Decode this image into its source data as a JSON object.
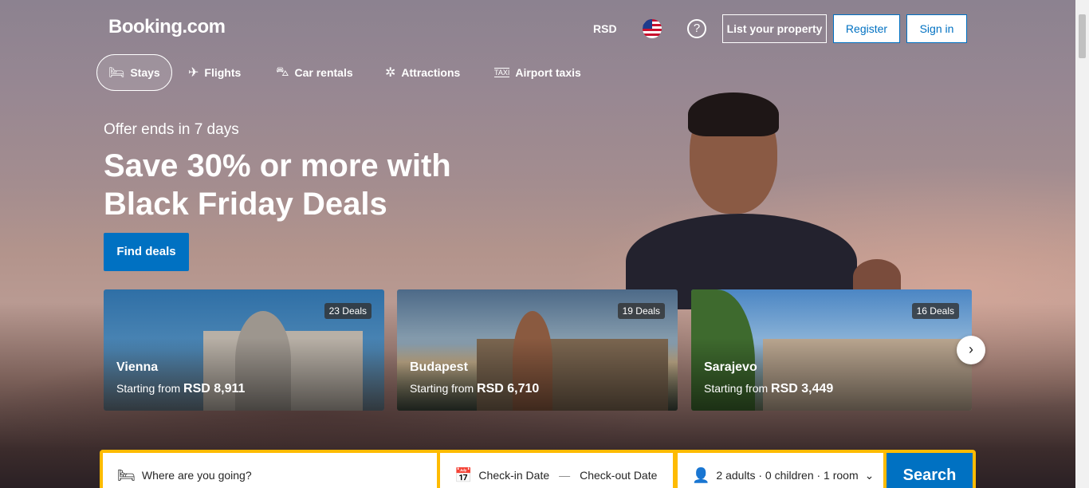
{
  "header": {
    "logo": "Booking.com",
    "currency": "RSD",
    "language_flag": "us-flag-icon",
    "help": "?",
    "list_property": "List your property",
    "register": "Register",
    "sign_in": "Sign in"
  },
  "nav": [
    {
      "label": "Stays",
      "icon": "bed-icon"
    },
    {
      "label": "Flights",
      "icon": "plane-icon"
    },
    {
      "label": "Car rentals",
      "icon": "car-icon"
    },
    {
      "label": "Attractions",
      "icon": "ferris-wheel-icon"
    },
    {
      "label": "Airport taxis",
      "icon": "taxi-icon"
    }
  ],
  "hero": {
    "offer": "Offer ends in 7 days",
    "title": "Save 30% or more with Black Friday Deals",
    "cta": "Find deals"
  },
  "deals": [
    {
      "city": "Vienna",
      "deals": "23 Deals",
      "starting": "Starting from",
      "price": "RSD 8,911"
    },
    {
      "city": "Budapest",
      "deals": "19 Deals",
      "starting": "Starting from",
      "price": "RSD 6,710"
    },
    {
      "city": "Sarajevo",
      "deals": "16 Deals",
      "starting": "Starting from",
      "price": "RSD 3,449"
    }
  ],
  "search": {
    "destination_placeholder": "Where are you going?",
    "checkin": "Check-in Date",
    "dash": "—",
    "checkout": "Check-out Date",
    "guests": "2 adults · 0 children · 1 room",
    "button": "Search"
  },
  "colors": {
    "brand": "#0071c2",
    "search_border": "#febb02"
  }
}
